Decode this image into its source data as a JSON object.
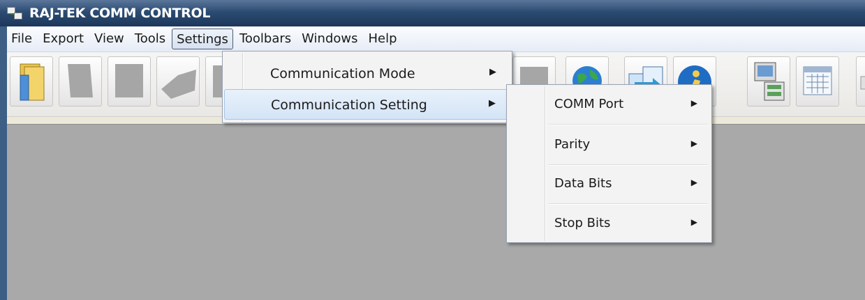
{
  "window": {
    "title": "RAJ-TEK COMM CONTROL"
  },
  "menubar": {
    "items": [
      "File",
      "Export",
      "View",
      "Tools",
      "Settings",
      "Toolbars",
      "Windows",
      "Help"
    ],
    "active": "Settings"
  },
  "toolbar": {
    "icons": [
      "folders-icon",
      "disabled-icon",
      "disabled-icon",
      "disabled-icon",
      "disabled-icon",
      "disabled-icon",
      "globe-icon",
      "transfer-icon",
      "help-agent-icon",
      "computer-icon",
      "calendar-icon",
      "extra-icon"
    ]
  },
  "settings_menu": {
    "items": [
      {
        "label": "Communication Mode",
        "arrow": "▶"
      },
      {
        "label": "Communication Setting",
        "arrow": "▶"
      }
    ]
  },
  "communication_submenu": {
    "items": [
      {
        "label": "COMM Port",
        "arrow": "▶"
      },
      {
        "label": "Parity",
        "arrow": "▶"
      },
      {
        "label": "Data Bits",
        "arrow": "▶"
      },
      {
        "label": "Stop Bits",
        "arrow": "▶"
      }
    ]
  },
  "colors": {
    "titlebar": "#2c4b72",
    "client_bg": "#a9a9a9",
    "menu_bg": "#f3f3f3",
    "hover": "#d4e4f6"
  }
}
